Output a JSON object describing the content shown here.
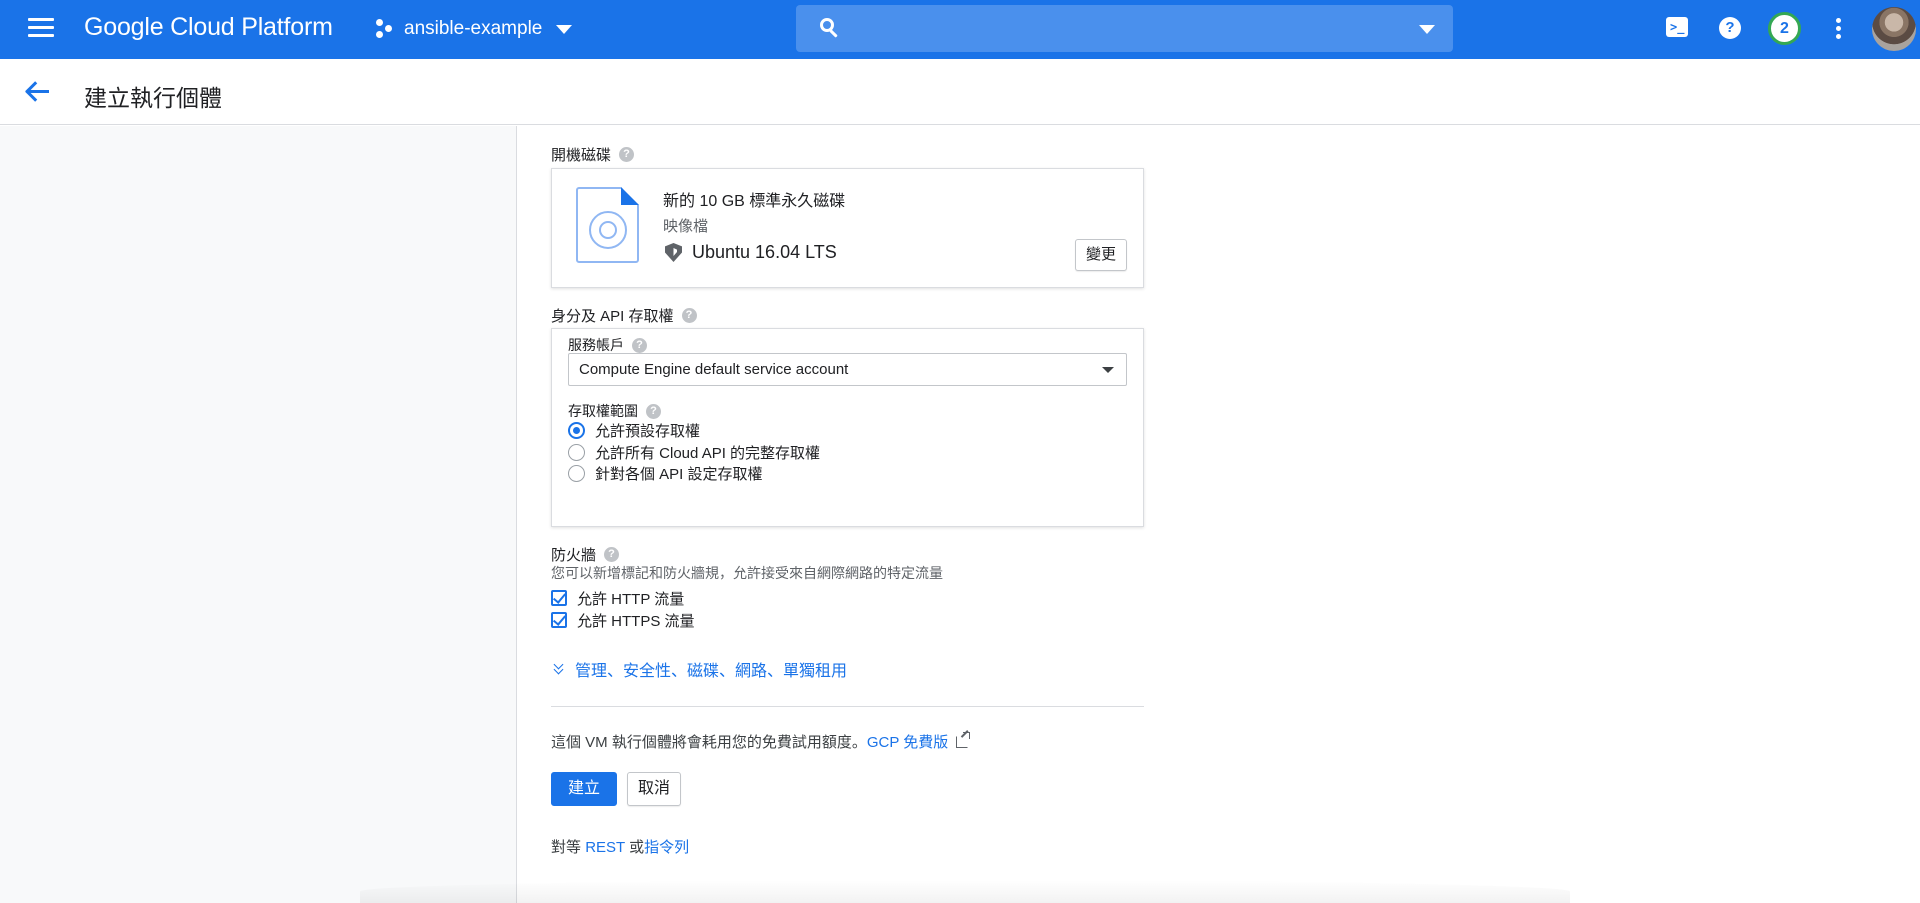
{
  "topbar": {
    "brand": "Google Cloud Platform",
    "project_name": "ansible-example",
    "search_placeholder": "",
    "notification_count": "2",
    "accent_color": "#1a73e8"
  },
  "header": {
    "title": "建立執行個體"
  },
  "boot_disk": {
    "section_label": "開機磁碟",
    "disk_name": "新的 10 GB 標準永久磁碟",
    "image_label": "映像檔",
    "os": "Ubuntu 16.04 LTS",
    "change_button": "變更"
  },
  "identity": {
    "section_label": "身分及 API 存取權",
    "service_account_label": "服務帳戶",
    "service_account_value": "Compute Engine default service account",
    "scope_label": "存取權範圍",
    "scope_options": [
      {
        "label": "允許預設存取權",
        "selected": true
      },
      {
        "label": "允許所有 Cloud API 的完整存取權",
        "selected": false
      },
      {
        "label": "針對各個 API 設定存取權",
        "selected": false
      }
    ]
  },
  "firewall": {
    "section_label": "防火牆",
    "description": "您可以新增標記和防火牆規，允許接受來自網際網路的特定流量",
    "options": [
      {
        "label": "允許 HTTP 流量",
        "checked": true
      },
      {
        "label": "允許 HTTPS 流量",
        "checked": true
      }
    ]
  },
  "advanced_link": "管理、安全性、磁碟、網路、單獨租用",
  "trial_note": {
    "text": "這個 VM 執行個體將會耗用您的免費試用額度。",
    "link": "GCP 免費版"
  },
  "actions": {
    "create": "建立",
    "cancel": "取消"
  },
  "equivalent": {
    "prefix": "對等",
    "rest_link": "REST",
    "or": "或",
    "cli_link": "指令列"
  }
}
